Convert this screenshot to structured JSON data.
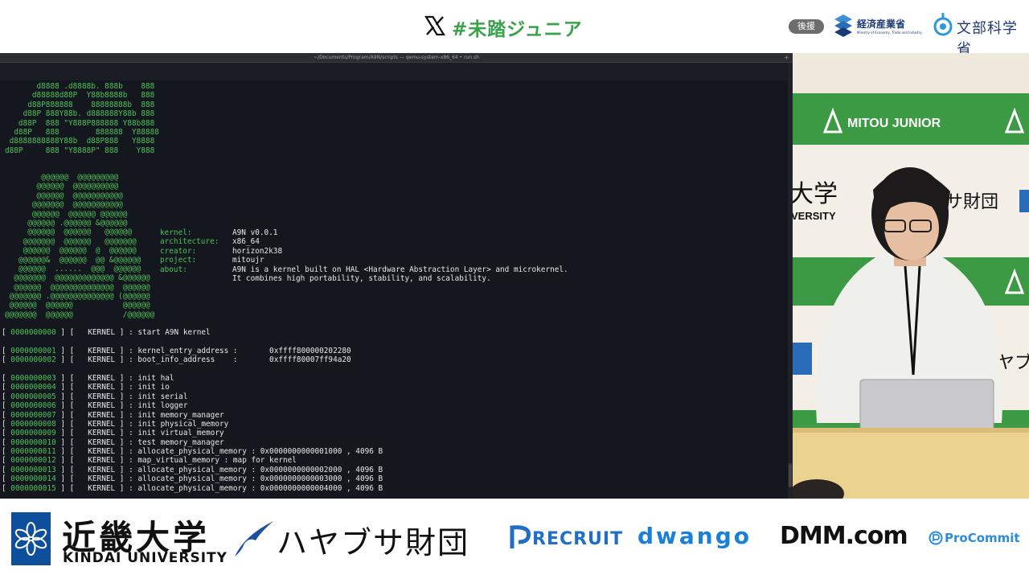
{
  "header": {
    "hashtag": "#未踏ジュニア",
    "kouen_label": "後援",
    "meti_name": "経済産業省",
    "meti_en": "Ministry of Economy, Trade and Industry",
    "mext_name": "文部科学省"
  },
  "terminal": {
    "title": "~/Documents/Program/A9N/scripts — qemu-system-x86_64 • run.sh",
    "plus": "+",
    "banner_a9n": [
      "       d8888 .d8888b. 888b    888",
      "      d88888d88P  Y88b8888b   888",
      "     d88P888888    88888888b  888",
      "    d88P 888Y88b. d888888Y88b 888",
      "   d88P  888 \"Y888P888888 Y88b888",
      "  d88P   888        888888  Y88888",
      " d8888888888Y88b  d88P888   Y8888",
      "d88P     888 \"Y8888P\" 888    Y888"
    ],
    "banner_art": [
      "        @@@@@@  @@@@@@@@@",
      "       @@@@@@  @@@@@@@@@@",
      "       @@@@@@  @@@@@@@@@@@",
      "      @@@@@@@  @@@@@@@@@@@",
      "      @@@@@@  @@@@@@ @@@@@@",
      "     @@@@@@ .@@@@@@ &@@@@@@",
      "     @@@@@@  @@@@@@   @@@@@@",
      "    @@@@@@@  @@@@@@   @@@@@@@",
      "    @@@@@@  @@@@@@  @  @@@@@@",
      "   @@@@@@&  @@@@@@  @@ &@@@@@@",
      "   @@@@@@  ......  @@@  @@@@@@",
      "  @@@@@@@  @@@@@@@@@@@@@ &@@@@@@",
      "  @@@@@@  @@@@@@@@@@@@@@  @@@@@@",
      " @@@@@@@ .@@@@@@@@@@@@@@ (@@@@@@",
      " @@@@@@  @@@@@@           @@@@@@",
      "@@@@@@@  @@@@@@           /@@@@@@"
    ],
    "info_labels": [
      "kernel:",
      "architecture:",
      "creator:",
      "project:",
      "about:"
    ],
    "info_values": [
      "A9N v0.0.1",
      "x86_64",
      "horizon2k38",
      "mitoujr",
      "A9N is a kernel built on HAL <Hardware Abstraction Layer> and microkernel.",
      "It combines high portability, stability, and scalability."
    ],
    "log": [
      {
        "num": "0000000000",
        "msg": "start A9N kernel"
      },
      {
        "blank": true
      },
      {
        "num": "0000000001",
        "msg": "kernel_entry_address :       0xffff800000202280"
      },
      {
        "num": "0000000002",
        "msg": "boot_info_address    :       0xffff80007ff94a20"
      },
      {
        "blank": true
      },
      {
        "num": "0000000003",
        "msg": "init hal"
      },
      {
        "num": "0000000004",
        "msg": "init io"
      },
      {
        "num": "0000000005",
        "msg": "init serial"
      },
      {
        "num": "0000000006",
        "msg": "init logger"
      },
      {
        "num": "0000000007",
        "msg": "init memory_manager"
      },
      {
        "num": "0000000008",
        "msg": "init physical_memory"
      },
      {
        "num": "0000000009",
        "msg": "init virtual_memory"
      },
      {
        "num": "0000000010",
        "msg": "test memory_manager"
      },
      {
        "num": "0000000011",
        "msg": "allocate_physical_memory : 0x0000000000001000 , 4096 B"
      },
      {
        "num": "0000000012",
        "msg": "map_virtual_memory : map for kernel"
      },
      {
        "num": "0000000013",
        "msg": "allocate_physical_memory : 0x0000000000002000 , 4096 B"
      },
      {
        "num": "0000000014",
        "msg": "allocate_physical_memory : 0x0000000000003000 , 4096 B"
      },
      {
        "num": "0000000015",
        "msg": "allocate_physical_memory : 0x0000000000004000 , 4096 B"
      }
    ],
    "log_tag": "KERNEL"
  },
  "camera": {
    "banner_text": "MITOU JUNIOR",
    "backdrop_kanji": "大学",
    "backdrop_en": "VERSITY",
    "backdrop_zaidan": "サ財団",
    "backdrop_ha": "ハヤブ"
  },
  "sponsors": {
    "kindai_name": "近畿大学",
    "kindai_en": "KINDAI UNIVERSITY",
    "hayabusa": "ハヤブサ財団",
    "recruit": "RECRUIT",
    "dwango": "dwango",
    "dmm": "DMM.com",
    "procommit": "ProCommit"
  },
  "colors": {
    "terminal_bg": "#14171d",
    "terminal_green": "#4ec25a",
    "hashtag_green": "#3aa24b",
    "meti_navy": "#1d3a78",
    "recruit_blue": "#1f6fc9",
    "dwango_blue": "#1a7fd8"
  }
}
